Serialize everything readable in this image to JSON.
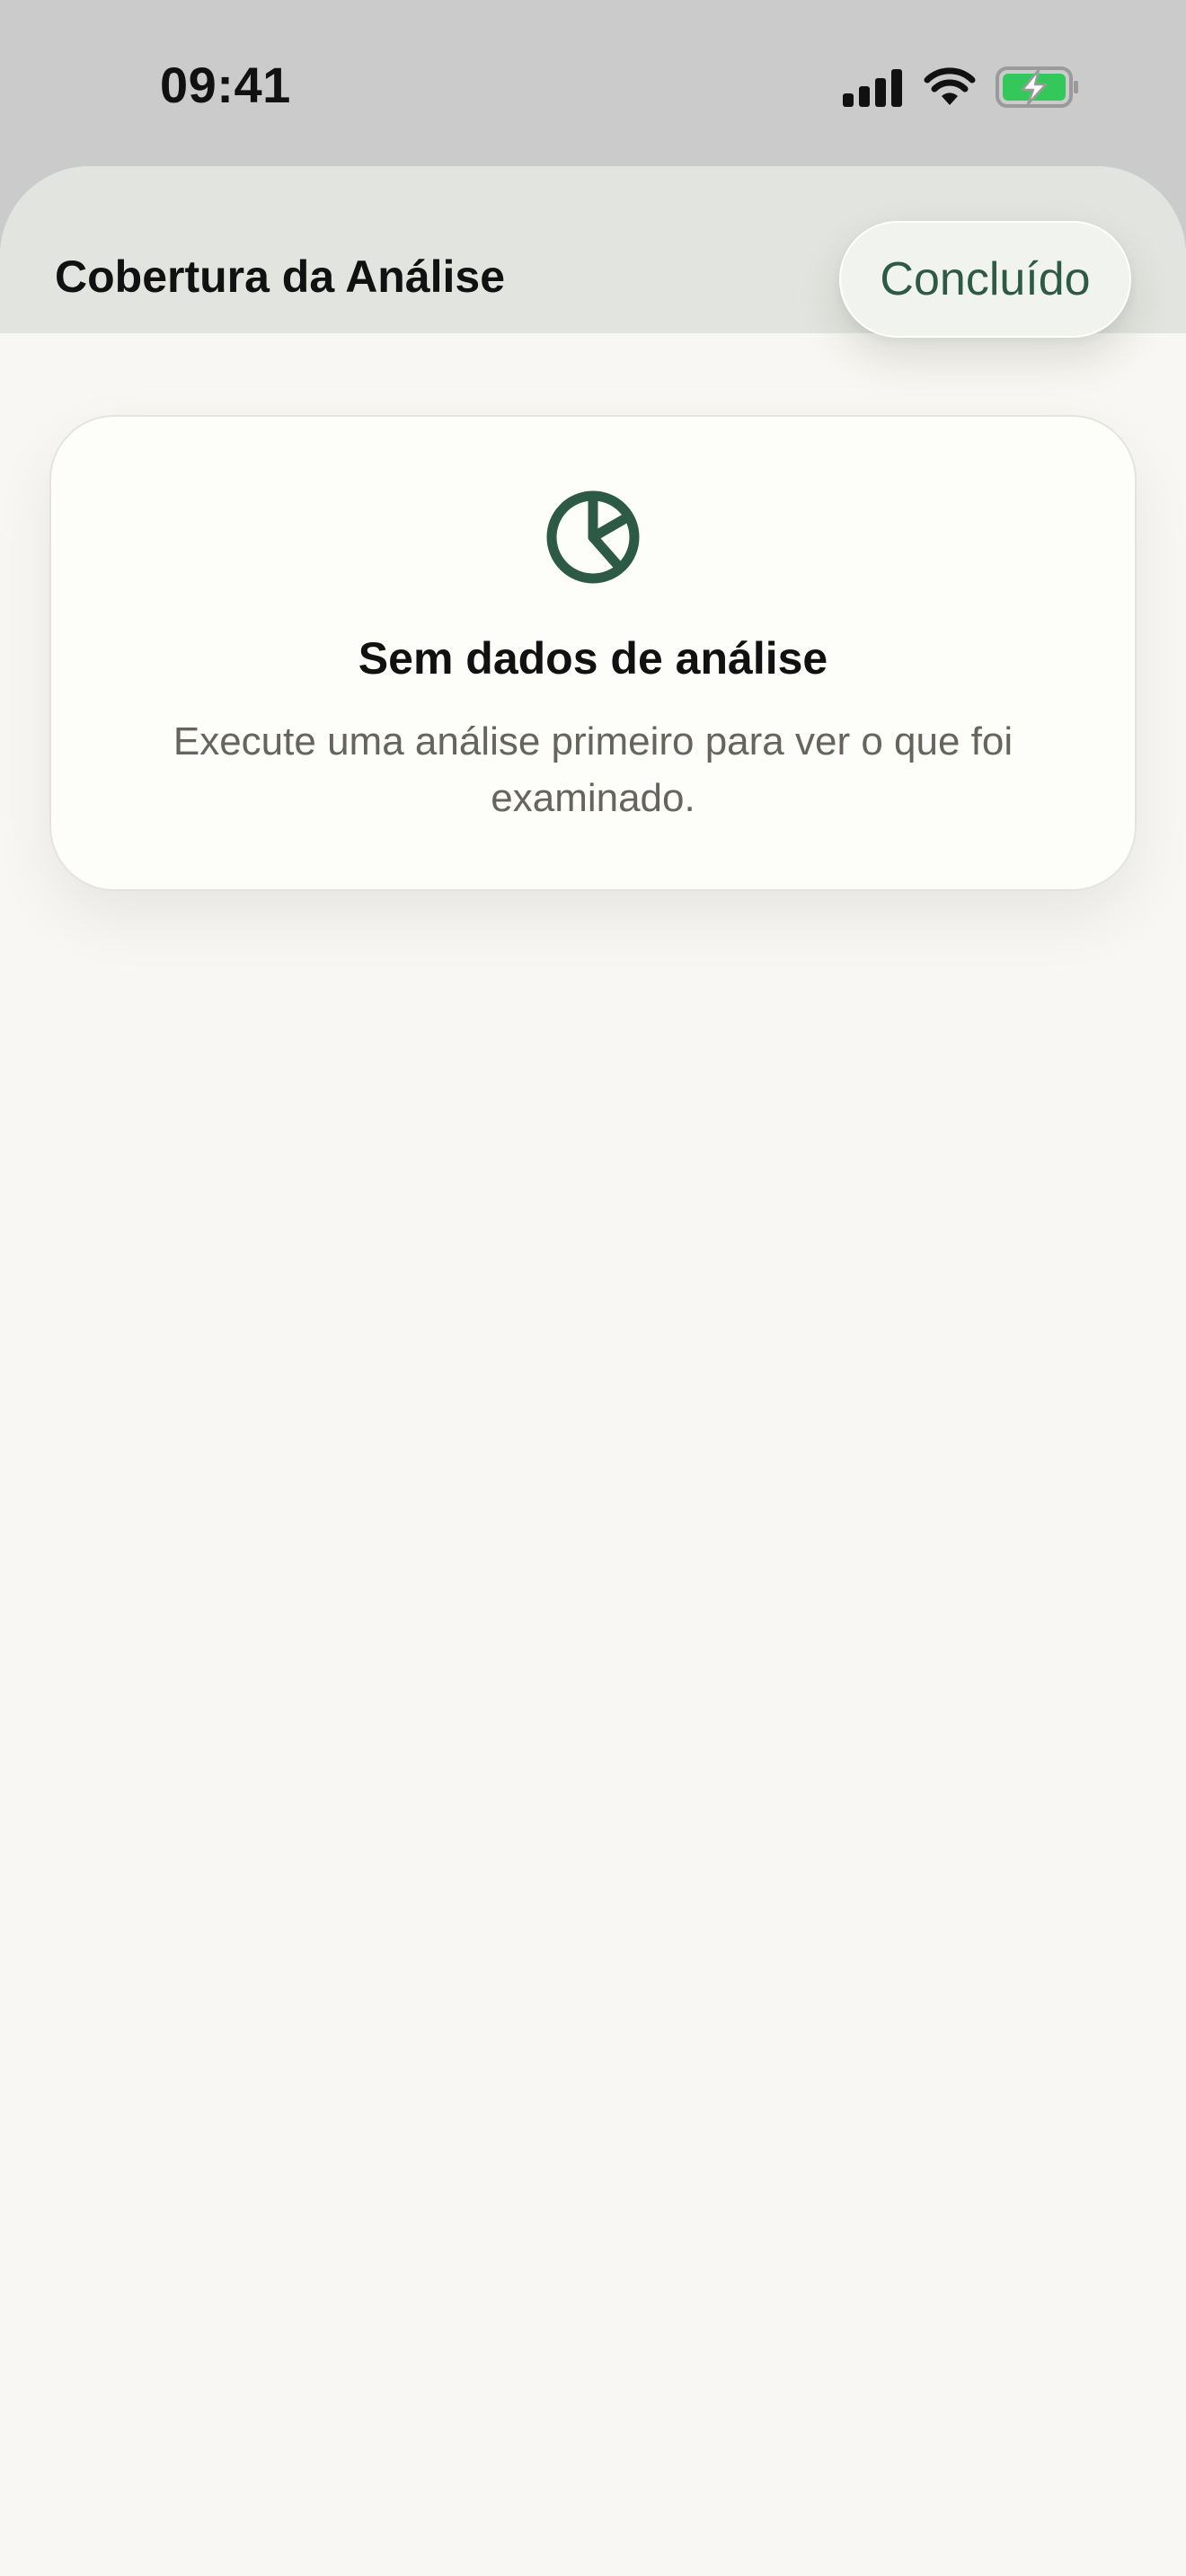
{
  "status_bar": {
    "time": "09:41",
    "icons": [
      "cellular-signal-icon",
      "wifi-icon",
      "battery-charging-icon"
    ],
    "battery_color": "#34c759"
  },
  "sheet": {
    "title": "Cobertura da Análise",
    "done_label": "Concluído",
    "accent_color": "#2d5a45"
  },
  "empty_state": {
    "icon": "pie-chart-icon",
    "title": "Sem dados de análise",
    "message": "Execute uma análise primeiro para ver o que foi examinado."
  }
}
